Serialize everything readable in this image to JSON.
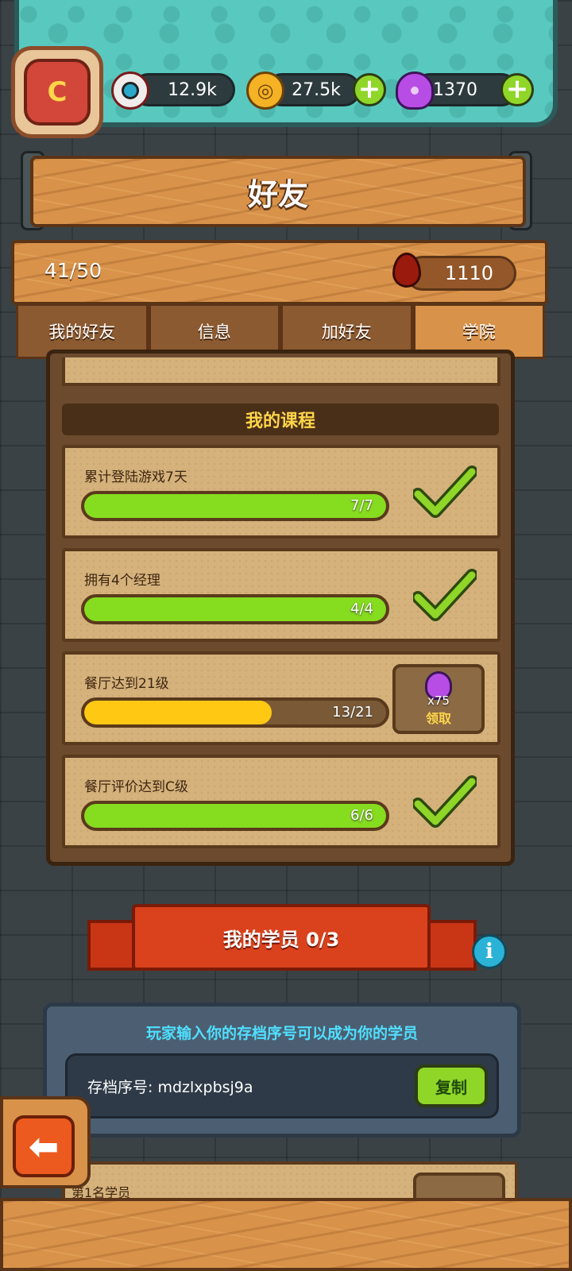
{
  "header": {
    "eyeball_count": "12.9k",
    "coin_count": "27.5k",
    "potion_count": "1370",
    "avatar_letter": "C"
  },
  "title": "好友",
  "stats": {
    "friends_count": "41/50",
    "blood_drops": "1110"
  },
  "tabs": [
    {
      "label": "我的好友",
      "active": false
    },
    {
      "label": "信息",
      "active": false
    },
    {
      "label": "加好友",
      "active": false
    },
    {
      "label": "学院",
      "active": true
    }
  ],
  "courses": {
    "heading": "我的课程",
    "items": [
      {
        "title": "累计登陆游戏7天",
        "progress": "7/7",
        "fraction": 1.0,
        "status": "complete",
        "bar_color": "#86dc1e"
      },
      {
        "title": "拥有4个经理",
        "progress": "4/4",
        "fraction": 1.0,
        "status": "complete",
        "bar_color": "#86dc1e"
      },
      {
        "title": "餐厅达到21级",
        "progress": "13/21",
        "fraction": 0.62,
        "status": "claim",
        "bar_color": "#ffc813",
        "reward_qty": "x75",
        "reward_action": "领取"
      },
      {
        "title": "餐厅评价达到C级",
        "progress": "6/6",
        "fraction": 1.0,
        "status": "complete",
        "bar_color": "#86dc1e"
      }
    ]
  },
  "students": {
    "ribbon": "我的学员 0/3",
    "hint": "玩家输入你的存档序号可以成为你的学员",
    "code_label": "存档序号: mdzlxpbsj9a",
    "copy_label": "复制",
    "first_student_label": "第1名学员"
  },
  "colors": {
    "accent_green": "#8fd629",
    "teal": "#59c9c0",
    "wood": "#d8924a",
    "ribbon_red": "#d9421c",
    "hint_cyan": "#4fe0ff"
  }
}
